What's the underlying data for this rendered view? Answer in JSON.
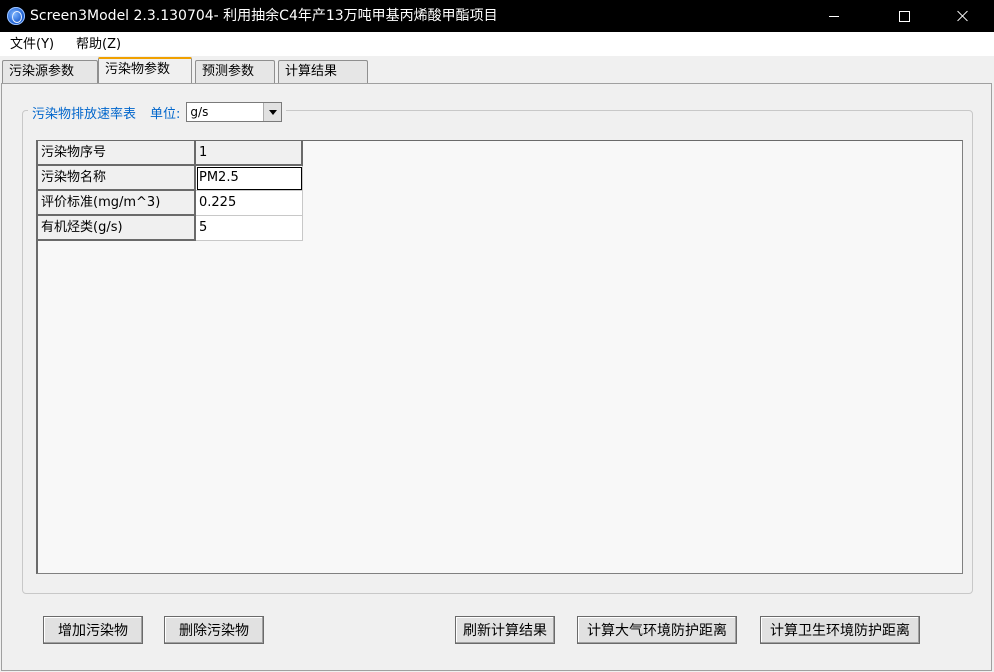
{
  "window": {
    "title": "Screen3Model 2.3.130704- 利用抽余C4年产13万吨甲基丙烯酸甲酯项目"
  },
  "menu": {
    "items": [
      {
        "label": "文件(Y)"
      },
      {
        "label": "帮助(Z)"
      }
    ]
  },
  "tabs": [
    {
      "label": "污染源参数",
      "active": false
    },
    {
      "label": "污染物参数",
      "active": true
    },
    {
      "label": "预测参数",
      "active": false
    },
    {
      "label": "计算结果",
      "active": false
    }
  ],
  "group": {
    "title": "污染物排放速率表",
    "unit_label": "单位:",
    "unit_value": "g/s"
  },
  "grid": {
    "rows": [
      {
        "header": "污染物序号",
        "value": "1"
      },
      {
        "header": "污染物名称",
        "value": "PM2.5"
      },
      {
        "header": "评价标准(mg/m^3)",
        "value": "0.225"
      },
      {
        "header": "有机烃类(g/s)",
        "value": "5"
      }
    ]
  },
  "buttons": {
    "add": "增加污染物",
    "delete": "删除污染物",
    "refresh": "刷新计算结果",
    "atmos": "计算大气环境防护距离",
    "health": "计算卫生环境防护距离"
  },
  "colors": {
    "title_bar": "#000000",
    "group_title": "#0066cc",
    "active_tab_accent": "#f0a000"
  }
}
